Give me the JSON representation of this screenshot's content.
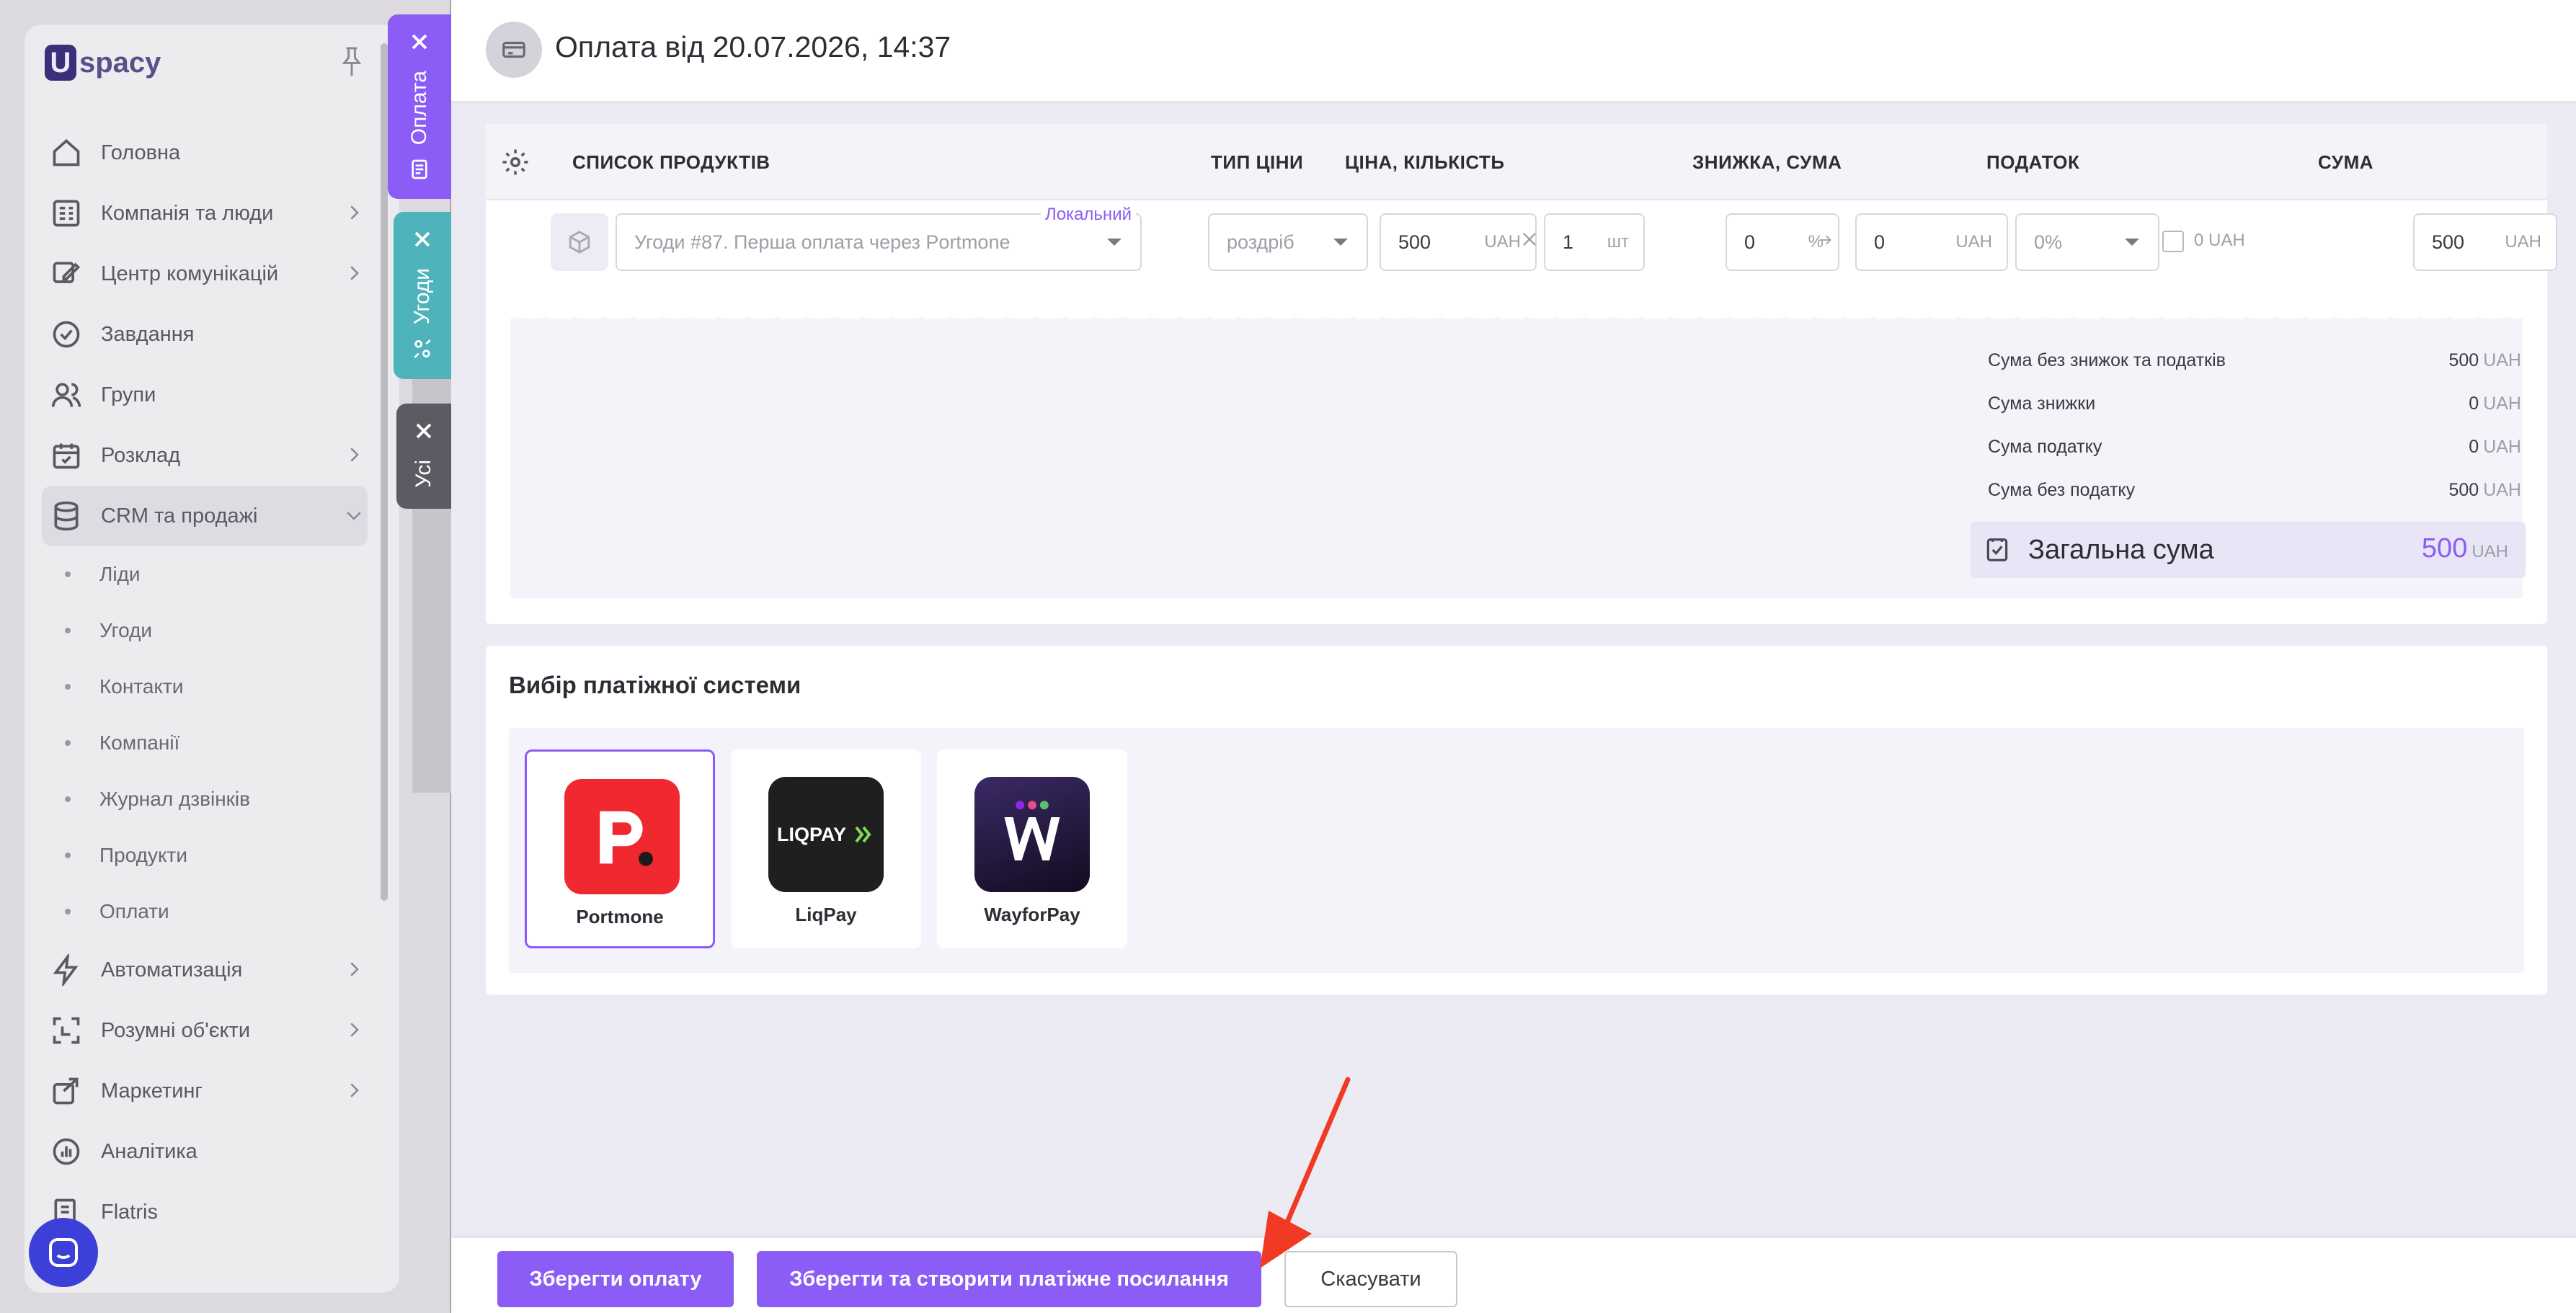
{
  "sidebar": {
    "logo_mark": "U",
    "logo_text": "spacy",
    "items": [
      {
        "label": "Головна"
      },
      {
        "label": "Компанія та люди"
      },
      {
        "label": "Центр комунікацій"
      },
      {
        "label": "Завдання"
      },
      {
        "label": "Групи"
      },
      {
        "label": "Розклад"
      },
      {
        "label": "CRM та продажі"
      },
      {
        "label": "Автоматизація"
      },
      {
        "label": "Розумні об'єкти"
      },
      {
        "label": "Маркетинг"
      },
      {
        "label": "Аналітика"
      },
      {
        "label": "Flatris"
      }
    ],
    "crm_sub": [
      {
        "label": "Ліди"
      },
      {
        "label": "Угоди"
      },
      {
        "label": "Контакти"
      },
      {
        "label": "Компанії"
      },
      {
        "label": "Журнал дзвінків"
      },
      {
        "label": "Продукти"
      },
      {
        "label": "Оплати"
      }
    ]
  },
  "slider_tabs": {
    "payment": "Оплата",
    "deals": "Угоди",
    "all": "Усі"
  },
  "header": {
    "title": "Оплата від 20.07.2026, 14:37"
  },
  "products": {
    "columns": {
      "list": "СПИСОК ПРОДУКТІВ",
      "price_type": "ТИП ЦІНИ",
      "price_qty": "ЦІНА, КІЛЬКІСТЬ",
      "discount": "ЗНИЖКА, СУМА",
      "tax": "ПОДАТОК",
      "sum": "СУМА"
    },
    "row": {
      "product_name": "Угоди #87. Перша оплата через Portmone",
      "badge": "Локальний",
      "price_type": "роздріб",
      "price": "500",
      "price_unit": "UAH",
      "qty": "1",
      "qty_unit": "шт",
      "discount_pct": "0",
      "discount_pct_unit": "%",
      "discount_sum": "0",
      "discount_sum_unit": "UAH",
      "tax_rate": "0%",
      "tax_amount": "0 UAH",
      "sum": "500",
      "sum_unit": "UAH"
    }
  },
  "summary": {
    "lines": [
      {
        "label": "Сума без знижок та податків",
        "value": "500",
        "unit": "UAH"
      },
      {
        "label": "Сума знижки",
        "value": "0",
        "unit": "UAH"
      },
      {
        "label": "Сума податку",
        "value": "0",
        "unit": "UAH"
      },
      {
        "label": "Сума без податку",
        "value": "500",
        "unit": "UAH"
      }
    ],
    "total_label": "Загальна сума",
    "total_value": "500",
    "total_unit": "UAH"
  },
  "payment_systems": {
    "title": "Вибір платіжної системи",
    "options": [
      {
        "name": "Portmone",
        "selected": true,
        "logo_text": "p."
      },
      {
        "name": "LiqPay",
        "selected": false,
        "logo_text": "LIQPAY"
      },
      {
        "name": "WayforPay",
        "selected": false,
        "logo_text": "W"
      }
    ]
  },
  "footer": {
    "save": "Зберегти оплату",
    "save_link": "Зберегти та створити платіжне посилання",
    "cancel": "Скасувати"
  },
  "colors": {
    "accent": "#8b5cf6",
    "teal_tab": "#4fb3bb",
    "portmone_red": "#f0282f",
    "arrow_red": "#f03a24"
  }
}
